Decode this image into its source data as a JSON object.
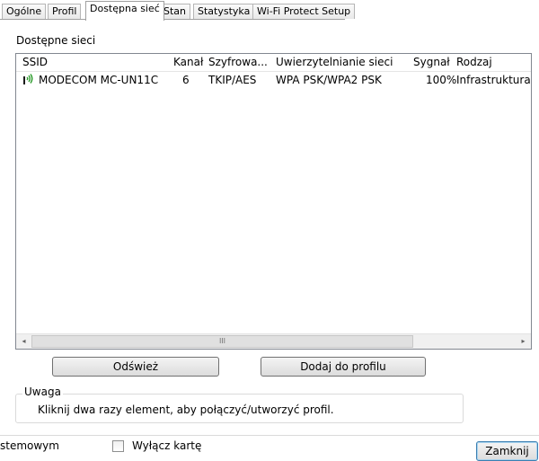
{
  "tabs": [
    "Ogólne",
    "Profil",
    "Dostępna sieć",
    "Stan",
    "Statystyka",
    "Wi-Fi Protect Setup"
  ],
  "group_label": "Dostępne sieci",
  "columns": [
    "SSID",
    "Kanał",
    "Szyfrowa...",
    "Uwierzytelnianie sieci",
    "Sygnał",
    "Rodzaj"
  ],
  "rows": [
    {
      "ssid": "MODECOM MC-UN11C",
      "channel": "6",
      "encryption": "TKIP/AES",
      "auth": "WPA PSK/WPA2 PSK",
      "signal": "100%",
      "type": "Infrastruktura"
    }
  ],
  "scrollbar": {
    "left_arrow": "◂",
    "thumb_grip": "III",
    "right_arrow": "▸"
  },
  "buttons": {
    "refresh": "Odśwież",
    "add_to_profile": "Dodaj do profilu",
    "close": "Zamknij"
  },
  "note": {
    "title": "Uwaga",
    "text": "Kliknij dwa razy element, aby połączyć/utworzyć profil."
  },
  "bottom": {
    "partial_label": "stemowym",
    "disable_card": "Wyłącz kartę"
  },
  "icons": {
    "wifi": "wifi-signal-icon"
  },
  "colors": {
    "wifi_icon": "#2a9a2a",
    "close_button_border": "#3c7fb1"
  }
}
